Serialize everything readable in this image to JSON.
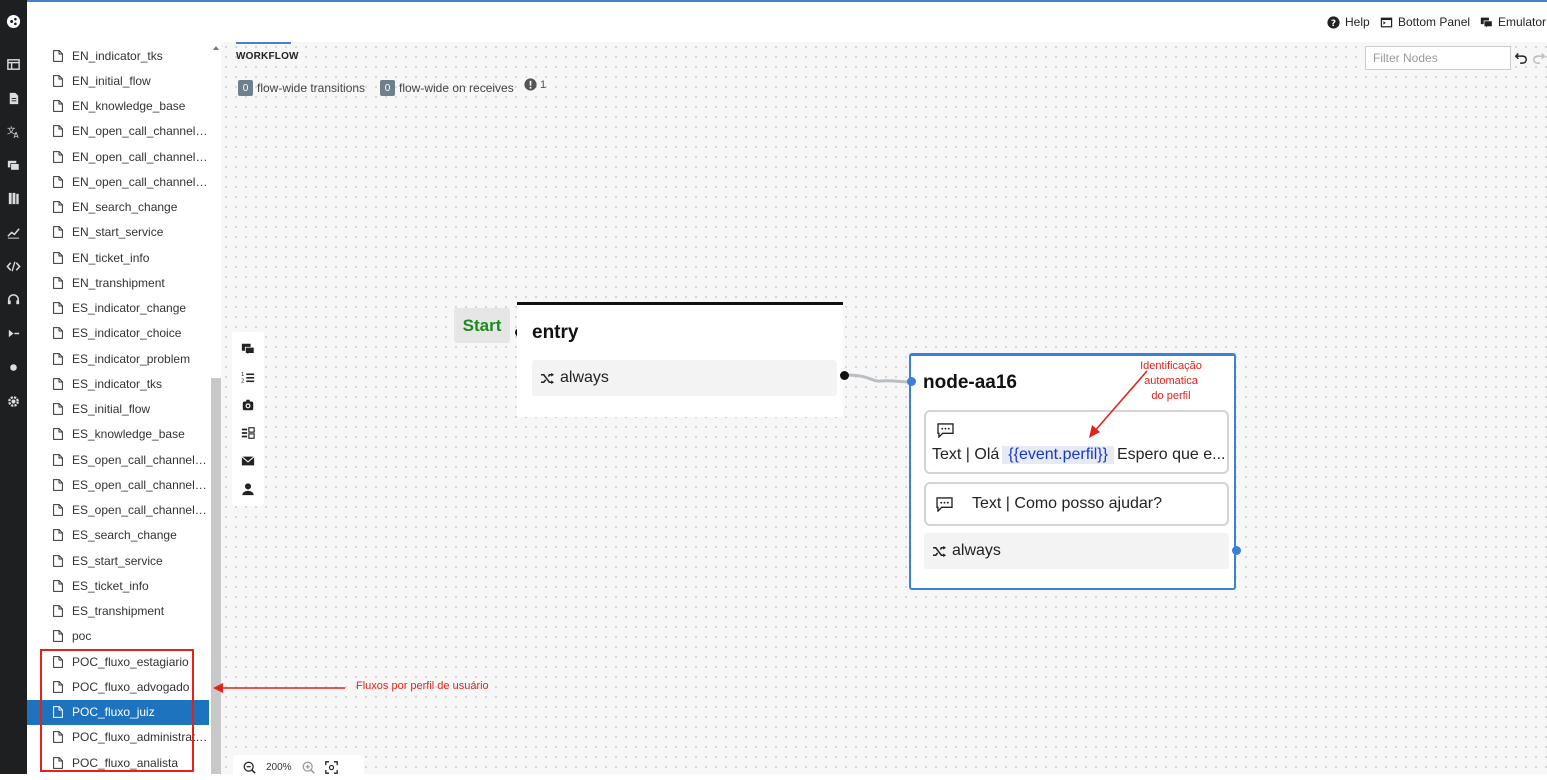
{
  "topbar": {
    "help": "Help",
    "bottom_panel": "Bottom Panel",
    "emulator": "Emulator"
  },
  "sidebar": {
    "items": [
      {
        "label": "EN_indicator_tks"
      },
      {
        "label": "EN_initial_flow"
      },
      {
        "label": "EN_knowledge_base"
      },
      {
        "label": "EN_open_call_channel_te..."
      },
      {
        "label": "EN_open_call_channel_t..."
      },
      {
        "label": "EN_open_call_channel_w..."
      },
      {
        "label": "EN_search_change"
      },
      {
        "label": "EN_start_service"
      },
      {
        "label": "EN_ticket_info"
      },
      {
        "label": "EN_transhipment"
      },
      {
        "label": "ES_indicator_change"
      },
      {
        "label": "ES_indicator_choice"
      },
      {
        "label": "ES_indicator_problem"
      },
      {
        "label": "ES_indicator_tks"
      },
      {
        "label": "ES_initial_flow"
      },
      {
        "label": "ES_knowledge_base"
      },
      {
        "label": "ES_open_call_channel_tel..."
      },
      {
        "label": "ES_open_call_channel_t..."
      },
      {
        "label": "ES_open_call_channel_w..."
      },
      {
        "label": "ES_search_change"
      },
      {
        "label": "ES_start_service"
      },
      {
        "label": "ES_ticket_info"
      },
      {
        "label": "ES_transhipment"
      },
      {
        "label": "poc"
      },
      {
        "label": "POC_fluxo_estagiario"
      },
      {
        "label": "POC_fluxo_advogado"
      },
      {
        "label": "POC_fluxo_juiz",
        "selected": true
      },
      {
        "label": "POC_fluxo_administrativo"
      },
      {
        "label": "POC_fluxo_analista"
      }
    ]
  },
  "canvas": {
    "tab_label": "WORKFLOW",
    "flow_wide_transitions_count": "0",
    "flow_wide_transitions_label": "flow-wide transitions",
    "flow_wide_receives_count": "0",
    "flow_wide_receives_label": "flow-wide on receives",
    "warning_count": "1",
    "filter_placeholder": "Filter Nodes",
    "zoom_level": "200%"
  },
  "nodes": {
    "start_label": "Start",
    "entry": {
      "title": "entry",
      "transition": "always"
    },
    "aa16": {
      "title": "node-aa16",
      "msg1_prefix": "Text | Olá",
      "msg1_variable": "{{event.perfil}}",
      "msg1_suffix": "Espero que e...",
      "msg2": "Text | Como posso ajudar?",
      "transition": "always"
    }
  },
  "annotations": {
    "perfil_line1": "Identificação",
    "perfil_line2": "automatica",
    "perfil_line3": "do perfil",
    "fluxos": "Fluxos por perfil de usuário",
    "color": "#e2231a"
  },
  "colors": {
    "accent": "#1e73be",
    "rail": "#1d1f21",
    "start_green": "#1e8a1e",
    "node_border_selected": "#3b7fd9"
  }
}
